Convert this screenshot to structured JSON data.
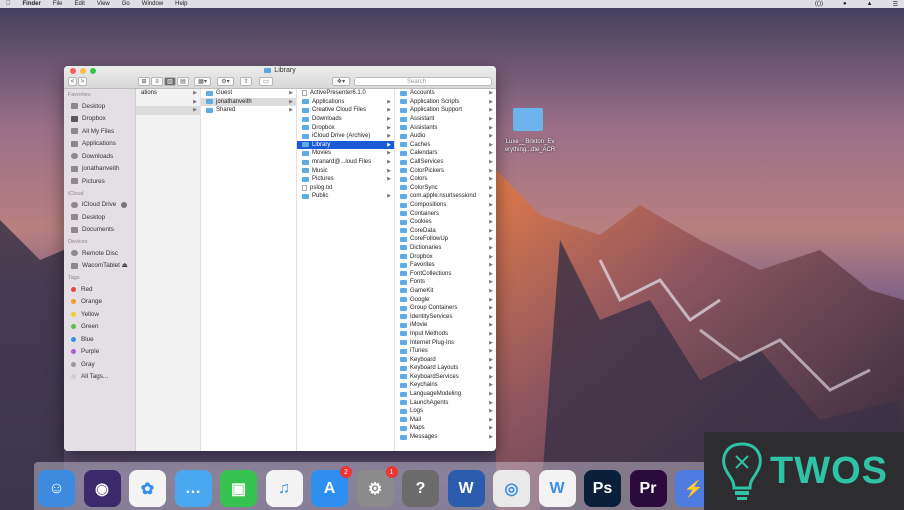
{
  "menubar": {
    "items": [
      "Finder",
      "File",
      "Edit",
      "View",
      "Go",
      "Window",
      "Help"
    ],
    "right": [
      "(())",
      "●",
      "▲",
      "☰"
    ]
  },
  "window": {
    "title": "Library",
    "search_placeholder": "Search",
    "toolbar": {
      "back": "<",
      "forward": ">",
      "view_icon": "⊞",
      "view_list": "≡",
      "view_column": "▥",
      "view_cover": "▤",
      "arrange": "▦▾",
      "action": "⚙▾",
      "share": "⇧",
      "tags": "▭",
      "dropbox": "❖▾"
    }
  },
  "sidebar": {
    "favorites_label": "Favorites",
    "favorites": [
      "Desktop",
      "Dropbox",
      "All My Files",
      "Applications",
      "Downloads",
      "jonathanveith",
      "Pictures"
    ],
    "icloud_label": "iCloud",
    "icloud": [
      "iCloud Drive",
      "Desktop",
      "Documents"
    ],
    "devices_label": "Devices",
    "devices": [
      "Remote Disc",
      "WacomTablet ⏏"
    ],
    "tags_label": "Tags",
    "tags": [
      {
        "name": "Red",
        "color": "#e8453c"
      },
      {
        "name": "Orange",
        "color": "#f39a2b"
      },
      {
        "name": "Yellow",
        "color": "#f2cf2f"
      },
      {
        "name": "Green",
        "color": "#5bc04a"
      },
      {
        "name": "Blue",
        "color": "#3a8ee6"
      },
      {
        "name": "Purple",
        "color": "#a75fd1"
      },
      {
        "name": "Gray",
        "color": "#9a9a9a"
      },
      {
        "name": "All Tags...",
        "color": "#cfcfcf"
      }
    ]
  },
  "column1": [
    "ations",
    "",
    ""
  ],
  "column2": [
    "Guest",
    "jonathanveith",
    "Shared"
  ],
  "column3": [
    "ActivePresenter6.1.0",
    "Applications",
    "Creative Cloud Files",
    "Downloads",
    "Dropbox",
    "iCloud Drive (Archive)",
    "Library",
    "Movies",
    "mranard@...loud Files",
    "Music",
    "Pictures",
    "pslog.txt",
    "Public"
  ],
  "column4": [
    "Accounts",
    "Application Scripts",
    "Application Support",
    "Assistant",
    "Assistants",
    "Audio",
    "Caches",
    "Calendars",
    "CallServices",
    "ColorPickers",
    "Colors",
    "ColorSync",
    "com.apple.nsurlsessiond",
    "Compositions",
    "Containers",
    "Cookies",
    "CoreData",
    "CoreFollowUp",
    "Dictionaries",
    "Dropbox",
    "Favorites",
    "FontCollections",
    "Fonts",
    "GameKit",
    "Google",
    "Group Containers",
    "IdentityServices",
    "iMovie",
    "Input Methods",
    "Internet Plug-Ins",
    "iTunes",
    "Keyboard",
    "Keyboard Layouts",
    "KeyboardServices",
    "Keychains",
    "LanguageModeling",
    "LaunchAgents",
    "Logs",
    "Mail",
    "Maps",
    "Messages"
  ],
  "desktop_file": "Luxe__Brixton_Ev erything...dle_ACR",
  "dock": {
    "items": [
      {
        "name": "finder",
        "color": "#3d8be0",
        "glyph": "☺"
      },
      {
        "name": "siri",
        "color": "#3a2a6a",
        "glyph": "◉"
      },
      {
        "name": "photos",
        "color": "#f4f4f4",
        "glyph": "✿"
      },
      {
        "name": "messages",
        "color": "#4aa8f0",
        "glyph": "…"
      },
      {
        "name": "facetime",
        "color": "#36c24f",
        "glyph": "▣"
      },
      {
        "name": "itunes",
        "color": "#f3f3f3",
        "glyph": "♫"
      },
      {
        "name": "app-store",
        "color": "#2f8ff0",
        "glyph": "A",
        "badge": "2"
      },
      {
        "name": "system-preferences",
        "color": "#8a8a8a",
        "glyph": "⚙",
        "badge": "1"
      },
      {
        "name": "help",
        "color": "#6b6b6b",
        "glyph": "?"
      },
      {
        "name": "word",
        "color": "#2b5cae",
        "glyph": "W"
      },
      {
        "name": "chrome",
        "color": "#e9e9e9",
        "glyph": "◎"
      },
      {
        "name": "wunderlist",
        "color": "#f3f3f3",
        "glyph": "W"
      },
      {
        "name": "photoshop",
        "color": "#0a1f3a",
        "glyph": "Ps"
      },
      {
        "name": "premiere",
        "color": "#2a0a3a",
        "glyph": "Pr"
      },
      {
        "name": "lightning",
        "color": "#4f7ce0",
        "glyph": "⚡"
      }
    ]
  },
  "watermark": {
    "text": "TWOS",
    "color": "#2fc3a6"
  }
}
